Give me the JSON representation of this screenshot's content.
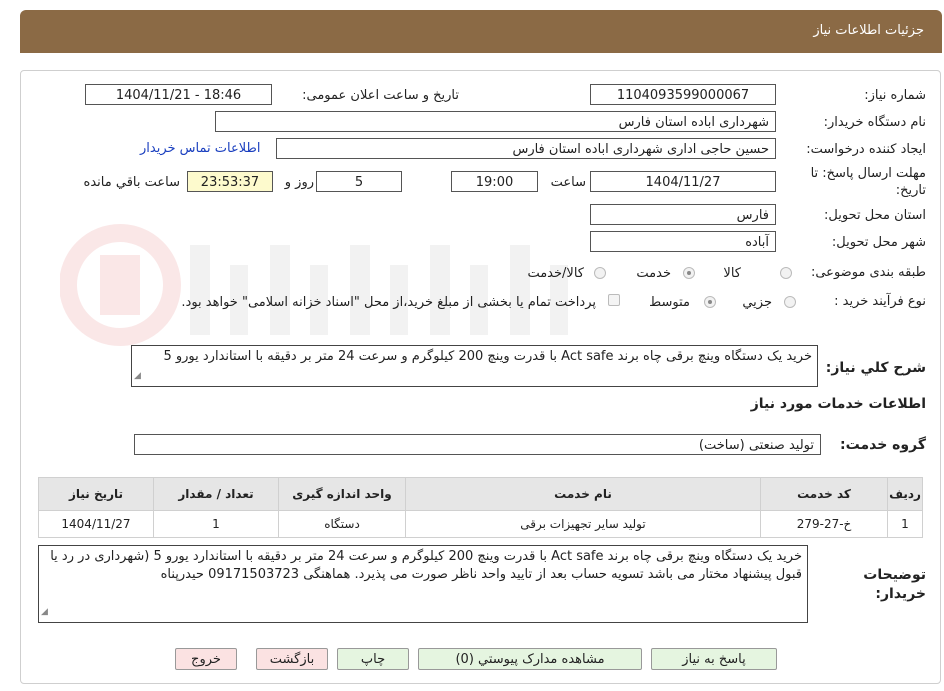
{
  "header": {
    "title": "جزئیات اطلاعات نیاز"
  },
  "fields": {
    "need_number_label": "شماره نیاز:",
    "need_number": "1104093599000067",
    "announce_label": "تاریخ و ساعت اعلان عمومی:",
    "announce_value": "1404/11/21 - 18:46",
    "buyer_org_label": "نام دستگاه خریدار:",
    "buyer_org": "شهرداری اباده استان فارس",
    "requester_label": "ایجاد کننده درخواست:",
    "requester": "حسین حاجی اداری شهرداری اباده استان فارس",
    "contact_link": "اطلاعات تماس خریدار",
    "deadline_label_1": "مهلت ارسال پاسخ: تا",
    "deadline_label_2": "تاریخ:",
    "deadline_date": "1404/11/27",
    "time_label": "ساعت",
    "deadline_time": "19:00",
    "days_value": "5",
    "days_label": "روز و",
    "remaining_time": "23:53:37",
    "remaining_label": "ساعت باقي مانده",
    "province_label": "استان محل تحویل:",
    "province": "فارس",
    "city_label": "شهر محل تحویل:",
    "city": "آباده",
    "category_label": "طبقه بندی موضوعی:",
    "category_options": [
      "کالا",
      "خدمت",
      "کالا/خدمت"
    ],
    "process_label": "نوع فرآیند خرید :",
    "process_options": [
      "جزيي",
      "متوسط"
    ],
    "payment_note": "پرداخت تمام یا بخشی از مبلغ خرید،از محل \"اسناد خزانه اسلامی\" خواهد بود.",
    "description_label": "شرح کلي نياز:",
    "description": "خرید یک دستگاه وینچ برقی چاه برند Act safe با قدرت وینچ 200 کیلوگرم و سرعت 24 متر بر دقیقه با استاندارد یورو 5",
    "services_heading": "اطلاعات خدمات مورد نياز",
    "service_group_label": "گروه خدمت:",
    "service_group": "تولید صنعتی (ساخت)",
    "buyer_notes_label_1": "توضیحات",
    "buyer_notes_label_2": "خریدار:",
    "buyer_notes": "خرید یک دستگاه وینچ برقی چاه برند Act safe با قدرت وینچ 200 کیلوگرم و سرعت 24 متر بر دقیقه با استاندارد یورو 5 (شهرداری در رد یا قبول پیشنهاد مختار می باشد تسویه حساب بعد از تایید واحد ناظر صورت می پذیرد. هماهنگی 09171503723 حیدرپناه"
  },
  "table": {
    "headers": [
      "ردیف",
      "کد خدمت",
      "نام خدمت",
      "واحد اندازه گیری",
      "تعداد / مقدار",
      "تاریخ نیاز"
    ],
    "rows": [
      [
        "1",
        "خ-27-279",
        "تولید سایر تجهیزات برقی",
        "دستگاه",
        "1",
        "1404/11/27"
      ]
    ]
  },
  "buttons": {
    "reply": "پاسخ به نیاز",
    "attachments": "مشاهده مدارک پیوستي (0)",
    "print": "چاپ",
    "back": "بازگشت",
    "exit": "خروج"
  },
  "colors": {
    "header_bg": "#8b6a45",
    "link": "#1a3fbf",
    "remaining_bg": "#fdfacd"
  }
}
